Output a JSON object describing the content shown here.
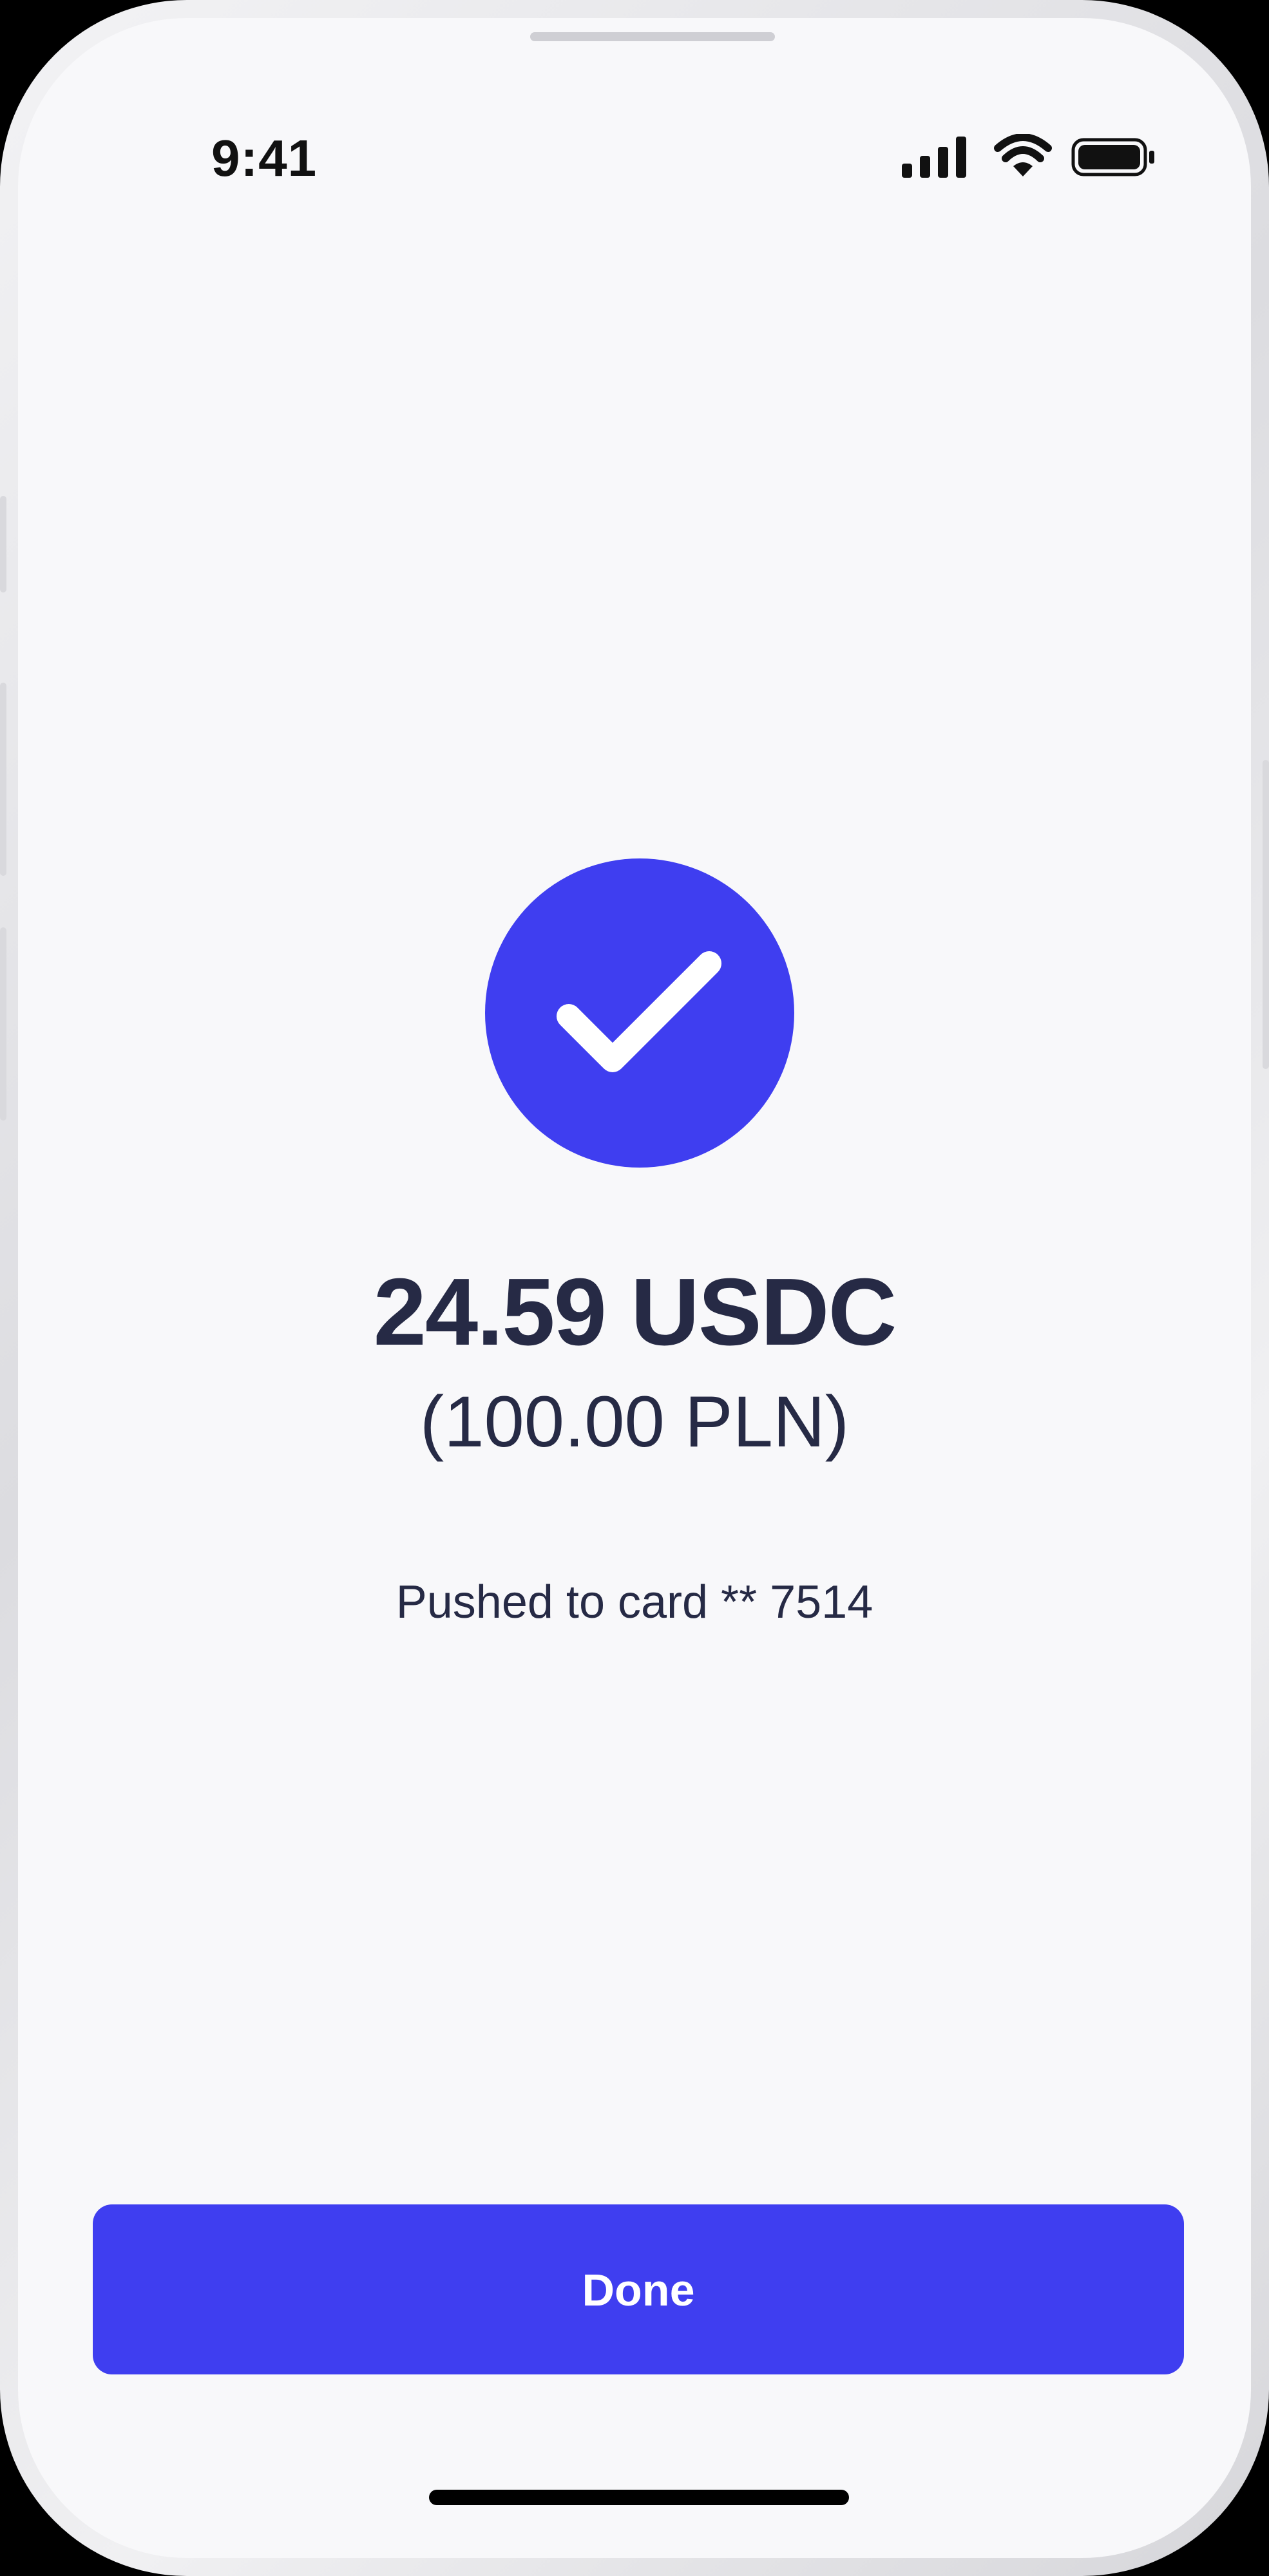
{
  "status_bar": {
    "time": "9:41",
    "icons": [
      "cellular-signal-icon",
      "wifi-icon",
      "battery-icon"
    ]
  },
  "success": {
    "icon": "checkmark-icon",
    "accent_color": "#3f3ef0"
  },
  "amount": {
    "primary": "24.59 USDC",
    "secondary": "(100.00 PLN)"
  },
  "message": "Pushed to card ** 7514",
  "actions": {
    "done_label": "Done"
  },
  "colors": {
    "background": "#f8f8fa",
    "text": "#262a45",
    "accent": "#3f3ef0"
  }
}
